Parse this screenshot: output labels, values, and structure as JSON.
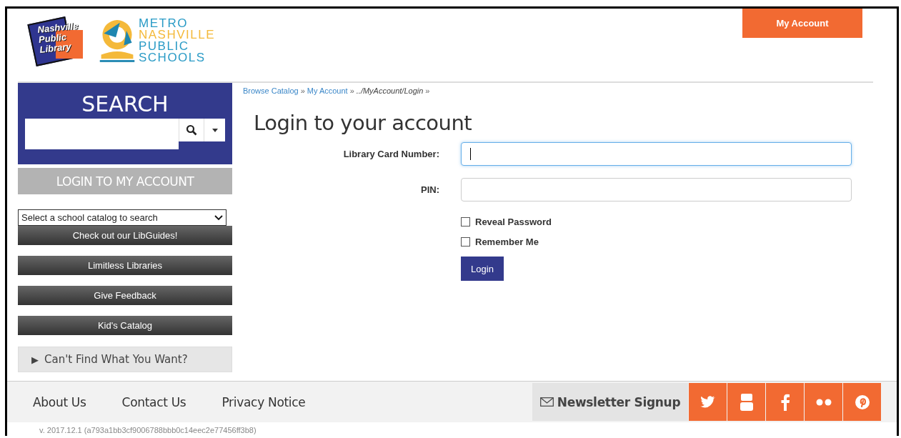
{
  "header": {
    "logos": [
      {
        "kind": "library",
        "lines": [
          "Nashville",
          "Public",
          "Library"
        ]
      },
      {
        "kind": "schools",
        "lines": [
          "METRO",
          "NASHVILLE",
          "PUBLIC",
          "SCHOOLS"
        ]
      }
    ],
    "account_button": "My Account"
  },
  "sidebar": {
    "search": {
      "title": "SEARCH"
    },
    "login_button": "LOGIN TO MY ACCOUNT",
    "catalog_select": "Select a school catalog to search",
    "links": [
      "Check out our LibGuides!",
      "Limitless Libraries",
      "Give Feedback",
      "Kid's Catalog"
    ],
    "expander": {
      "arrow": "▶",
      "label": "Can't Find What You Want?",
      "expanded": false
    }
  },
  "breadcrumbs": [
    {
      "label": "Browse Catalog",
      "kind": "link",
      "separator": "»"
    },
    {
      "label": "My Account",
      "kind": "link",
      "separator": "»"
    },
    {
      "label": "../MyAccount/Login",
      "kind": "current",
      "separator": "»"
    }
  ],
  "form": {
    "title": "Login to your account",
    "fields": [
      {
        "label": "Library Card Number:",
        "focused": true
      },
      {
        "label": "PIN:",
        "focused": false
      }
    ],
    "checkboxes": [
      {
        "label": "Reveal Password",
        "checked": false
      },
      {
        "label": "Remember Me",
        "checked": false
      }
    ],
    "submit": "Login"
  },
  "footer": {
    "links": [
      "About Us",
      "Contact Us",
      "Privacy Notice"
    ],
    "newsletter": "Newsletter Signup",
    "social": [
      {
        "kind": "twitter"
      },
      {
        "kind": "youtube"
      },
      {
        "kind": "facebook"
      },
      {
        "kind": "flickr"
      },
      {
        "kind": "pinterest"
      }
    ],
    "version": "v. 2017.12.1 (a793a1bb3cf9006788bbb0c14eec2e77456ff3b8)"
  }
}
